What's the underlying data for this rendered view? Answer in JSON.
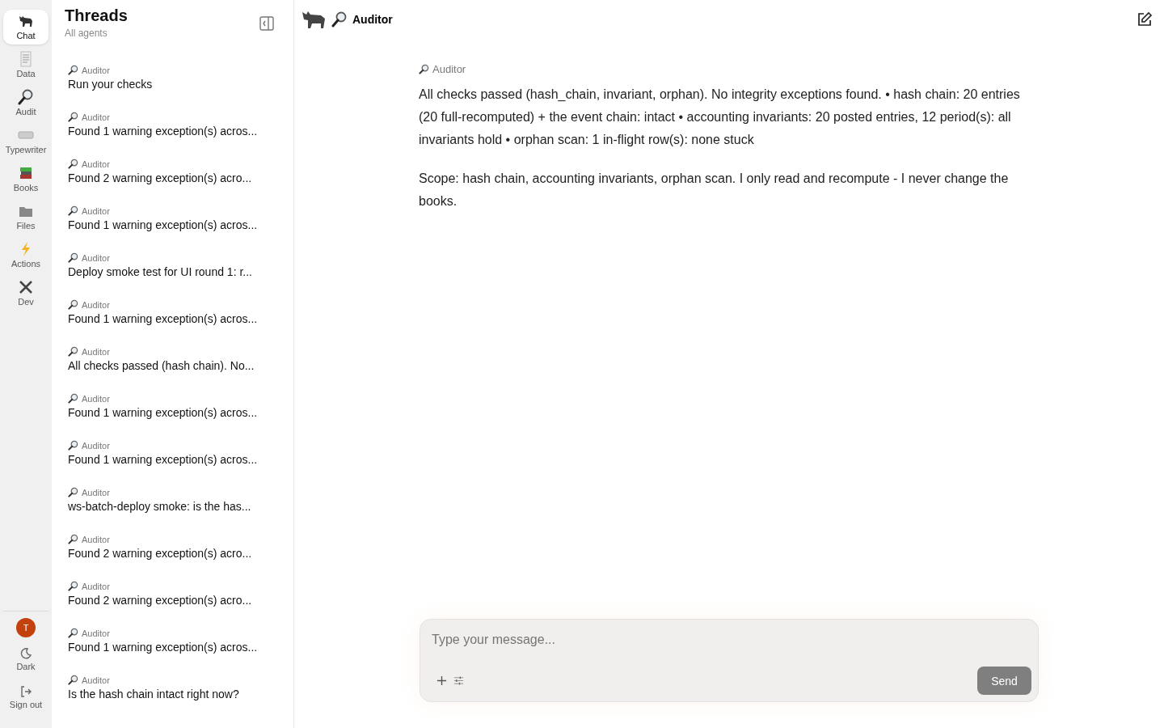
{
  "nav": [
    {
      "label": "Chat",
      "selected": true
    },
    {
      "label": "Data",
      "selected": false
    },
    {
      "label": "Audit",
      "selected": false
    },
    {
      "label": "Typewriter",
      "selected": false
    },
    {
      "label": "Books",
      "selected": false
    },
    {
      "label": "Files",
      "selected": false
    },
    {
      "label": "Actions",
      "selected": false
    },
    {
      "label": "Dev",
      "selected": false
    }
  ],
  "user": {
    "initial": "T"
  },
  "bottom_nav": [
    "Dark",
    "Sign out"
  ],
  "threads_panel": {
    "title": "Threads",
    "subtitle": "All agents",
    "items": [
      {
        "agent": "Auditor",
        "title": "Run your checks"
      },
      {
        "agent": "Auditor",
        "title": "Found 1 warning exception(s) acros..."
      },
      {
        "agent": "Auditor",
        "title": "Found 2 warning exception(s) acro..."
      },
      {
        "agent": "Auditor",
        "title": "Found 1 warning exception(s) acros..."
      },
      {
        "agent": "Auditor",
        "title": "Deploy smoke test for UI round 1: r..."
      },
      {
        "agent": "Auditor",
        "title": "Found 1 warning exception(s) acros..."
      },
      {
        "agent": "Auditor",
        "title": "All checks passed (hash chain). No..."
      },
      {
        "agent": "Auditor",
        "title": "Found 1 warning exception(s) acros..."
      },
      {
        "agent": "Auditor",
        "title": "Found 1 warning exception(s) acros..."
      },
      {
        "agent": "Auditor",
        "title": "ws-batch-deploy smoke: is the has..."
      },
      {
        "agent": "Auditor",
        "title": "Found 2 warning exception(s) acro..."
      },
      {
        "agent": "Auditor",
        "title": "Found 2 warning exception(s) acro..."
      },
      {
        "agent": "Auditor",
        "title": "Found 1 warning exception(s) acros..."
      },
      {
        "agent": "Auditor",
        "title": "Is the hash chain intact right now?"
      }
    ]
  },
  "chat": {
    "agent": "Auditor",
    "message": {
      "agent": "Auditor",
      "paragraphs": [
        "All checks passed (hash_chain, invariant, orphan). No integrity exceptions found. • hash chain: 20 entries (20 full-recomputed) + the event chain: intact • accounting invariants: 20 posted entries, 12 period(s): all invariants hold • orphan scan: 1 in-flight row(s): none stuck",
        "Scope: hash chain, accounting invariants, orphan scan. I only read and recompute - I never change the books."
      ]
    },
    "composer": {
      "placeholder": "Type your message...",
      "send": "Send"
    }
  }
}
